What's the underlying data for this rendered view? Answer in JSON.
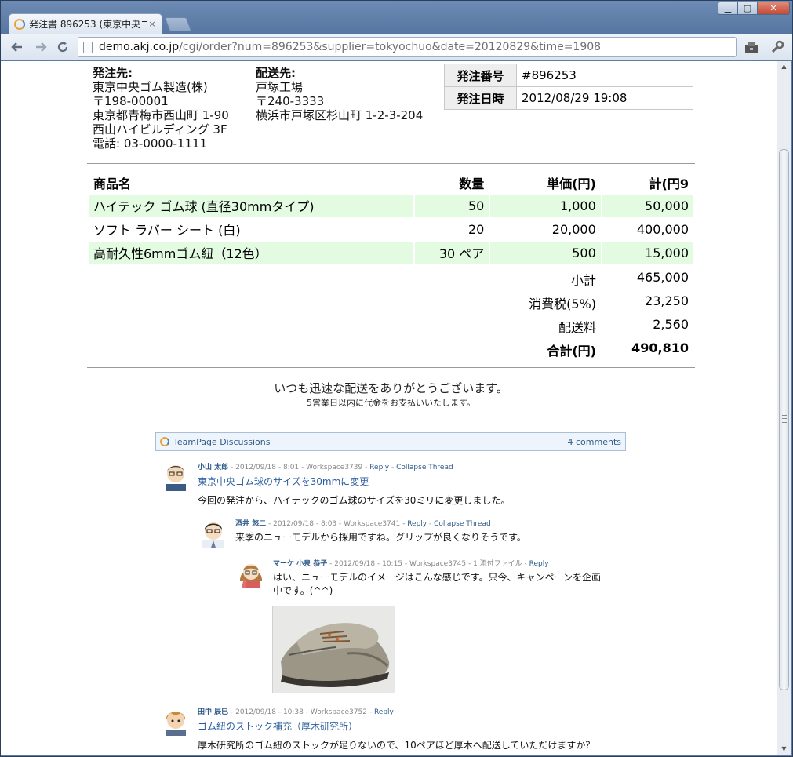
{
  "browser": {
    "tab_title": "発注書 896253 (東京中央ゴ",
    "tab_close": "×",
    "min_label": "▁",
    "max_label": "▢",
    "close_label": "✕",
    "url_host": "demo.akj.co.jp",
    "url_path": "/cgi/order?num=896253&supplier=tokyochuo&date=20120829&time=1908"
  },
  "order": {
    "supplier_label": "発注先:",
    "supplier_lines": [
      "東京中央ゴム製造(株)",
      "〒198-00001",
      "東京都青梅市西山町 1-90",
      "西山ハイビルディング 3F",
      "電話: 03-0000-1111"
    ],
    "ship_label": "配送先:",
    "ship_lines": [
      "戸塚工場",
      "〒240-3333",
      "横浜市戸塚区杉山町 1-2-3-204"
    ],
    "number_label": "発注番号",
    "number_value": "#896253",
    "date_label": "発注日時",
    "date_value": "2012/08/29 19:08",
    "columns": [
      "商品名",
      "数量",
      "単価(円)",
      "計(円9"
    ],
    "items": [
      {
        "name": "ハイテック ゴム球 (直径30mmタイプ)",
        "qty": "50",
        "price": "1,000",
        "total": "50,000"
      },
      {
        "name": "ソフト ラバー シート (白)",
        "qty": "20",
        "price": "20,000",
        "total": "400,000"
      },
      {
        "name": "高耐久性6mmゴム紐（12色）",
        "qty": "30 ペア",
        "price": "500",
        "total": "15,000"
      }
    ],
    "subtotal_label": "小計",
    "subtotal": "465,000",
    "tax_label": "消費税(5%)",
    "tax": "23,250",
    "shipping_label": "配送料",
    "shipping": "2,560",
    "grand_label": "合計(円)",
    "grand": "490,810",
    "thanks": "いつも迅速な配送をありがとうございます。",
    "thanks_sub": "5営業日以内に代金をお支払いいたします。"
  },
  "discussion": {
    "title": "TeamPage Discussions",
    "count": "4 comments",
    "comments": [
      {
        "author": "小山 太郎",
        "meta": " - 2012/09/18 - 8:01 - Workspace3739 - ",
        "reply": "Reply",
        "collapse": "Collapse Thread",
        "subject": "東京中央ゴム球のサイズを30mmに変更",
        "body": "今回の発注から、ハイテックのゴム球のサイズを30ミリに変更しました。"
      },
      {
        "author": "酒井 悠二",
        "meta": " - 2012/09/18 - 8:03 - Workspace3741 - ",
        "reply": "Reply",
        "collapse": "Collapse Thread",
        "body": "来季のニューモデルから採用ですね。グリップが良くなりそうです。"
      },
      {
        "author": "マーケ 小泉 恭子",
        "meta": " - 2012/09/18 - 10:15 - Workspace3745 - 1 添付ファイル - ",
        "reply": "Reply",
        "body": "はい、ニューモデルのイメージはこんな感じです。只今、キャンペーンを企画中です。(^^)"
      },
      {
        "author": "田中 辰巳",
        "meta": " - 2012/09/18 - 10:38 - Workspace3752 - ",
        "reply": "Reply",
        "subject": "ゴム紐のストック補充（厚木研究所）",
        "body": "厚木研究所のゴム紐のストックが足りないので、10ペアほど厚木へ配送していただけますか？"
      }
    ]
  }
}
